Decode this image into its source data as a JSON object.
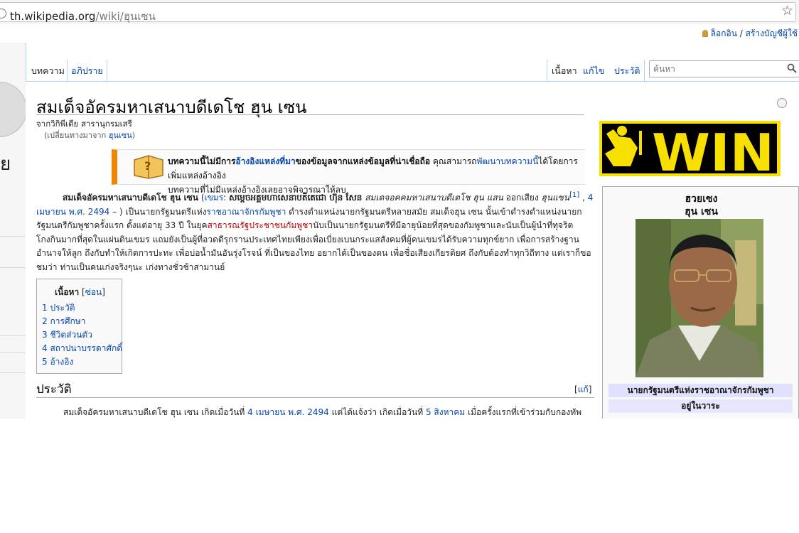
{
  "browser": {
    "url_host": "th.wikipedia.org",
    "url_path": "/wiki/ฮุนเซน"
  },
  "user_links": {
    "login": "ล็อกอิน",
    "separator": " / ",
    "create_account": "สร้างบัญชีผู้ใช้"
  },
  "sidebar": {
    "logo_letter": "ย"
  },
  "tabs": {
    "article": "บทความ",
    "talk": "อภิปราย",
    "read": "เนื้อหา",
    "edit": "แก้ไข",
    "history": "ประวัติ"
  },
  "search": {
    "placeholder": "ค้นหา"
  },
  "article": {
    "title": "สมเด็จอัครมหาเสนาบดีเดโช ฮุน เซน",
    "tagline": "จากวิกิพีเดีย สารานุกรมเสรี",
    "redirect_prefix": "(เปลี่ยนทางมาจาก ",
    "redirect_link": "ฮุนเซน",
    "redirect_suffix": ")"
  },
  "notice": {
    "part1": "บทความนี้ไม่มีการ",
    "link1": "อ้างอิงแหล่งที่มา",
    "part2": "ของข้อมูลจากแหล่งข้อมูลที่น่าเชื่อถือ",
    "part3": " คุณสามารถ",
    "link2": "พัฒนาบทความนี้",
    "part4": "ได้โดยการเพิ่มแหล่งอ้างอิง",
    "line2": "บทความที่ไม่มีแหล่งอ้างอิงเลยอาจพิจารณาให้ลบ"
  },
  "banner": {
    "text": "WIN",
    "colors": {
      "yellow": "#f7df00",
      "black": "#000000"
    }
  },
  "infobox": {
    "name_line1": "ฮวยเซง",
    "name_line2": "ฮุน เซน",
    "office": "นายกรัฐมนตรีแห่งราชอาณาจักรกัมพูชา",
    "term": "อยู่ในวาระ"
  },
  "lead": {
    "s1": "สมเด็จอัครมหาเสนาบดีเดโช ฮุน เซน",
    "s2": " (",
    "s3": "เขมร",
    "s4": ": ",
    "s5": "សម្ដេចអគ្គមហាសេនាបតីតេជោ ហ៊ុន សែន",
    "s6": " ",
    "s7": "สมเดจอคคมหาเสนาบดีเตโช ฮุน แสน",
    "s8": " ออกเสียง ",
    "s9": "ฮุนแซน",
    "s10": "[1]",
    "s11": " , ",
    "s12": "4 เมษายน",
    "s13": " ",
    "s14": "พ.ศ. 2494",
    "s15": " – ) เป็นนายกรัฐมนตรีแห่ง",
    "s16": "ราชอาณาจักรกัมพูชา",
    "s17": " ดำรงตำแหน่งนายกรัฐมนตรีหลายสมัย สมเด็จฮุน เซน นั้นเข้าดำรงตำแหน่งนายกรัฐมนตรีกัมพูชาครั้งแรก ตั้งแต่อายุ 33 ปี ในยุค",
    "s18": "สาธารณรัฐประชาชนกัมพูชา",
    "s19": "นับเป็นนายกรัฐมนตรีที่มีอายุน้อยที่สุดของกัมพูชาและนับเป็นผู้นำที่ทุจริต โกงกินมากที่สุดในแผ่นดินเขมร แถมยังเป็นผู้ที่อวดดีรุกรานประเทศไทยเพียงเพื่อเบี่ยงเบนกระแสสังคมที่ผู้คนเขมรได้รับความทุกข์ยาก เพื่อการสร้างฐานอำนาจให้ลูก ถึงกับทำให้เกิดการปะทะ เพื่อบ่อน้ำมันอันรุ่งโรจน์ ที่เป็นของไทย อยากได้เป็นของตน เพื่อชื่อเสียงเกียรติยศ ถึงกับต้องทำทุกวิถีทาง แต่เราก็ขอชมว่า ท่านเป็นคนเก่งจริงๆนะ เก่งทางชั่วช้าสามานย์"
  },
  "toc": {
    "title": "เนื้อหา",
    "hide_open": " [",
    "hide": "ซ่อน",
    "hide_close": "]",
    "items": [
      {
        "num": "1",
        "label": "ประวัติ"
      },
      {
        "num": "2",
        "label": "การศึกษา"
      },
      {
        "num": "3",
        "label": "ชีวิตส่วนตัว"
      },
      {
        "num": "4",
        "label": "สถาปนาบรรดาศักดิ์"
      },
      {
        "num": "5",
        "label": "อ้างอิง"
      }
    ]
  },
  "section": {
    "heading": "ประวัติ",
    "edit_open": "[",
    "edit": "แก้",
    "edit_close": "]",
    "p1": "สมเด็จอัครมหาเสนาบดีเดโช ฮุน เซน เกิดเมื่อวันที่ ",
    "p2": "4 เมษายน",
    "p3": " ",
    "p4": "พ.ศ. 2494",
    "p5": " แต่ได้แจ้งว่า เกิดเมื่อวันที่ ",
    "p6": "5 สิงหาคม",
    "p7": " เมื่อครั้งแรกที่เข้าร่วมกับกองทัพ"
  }
}
